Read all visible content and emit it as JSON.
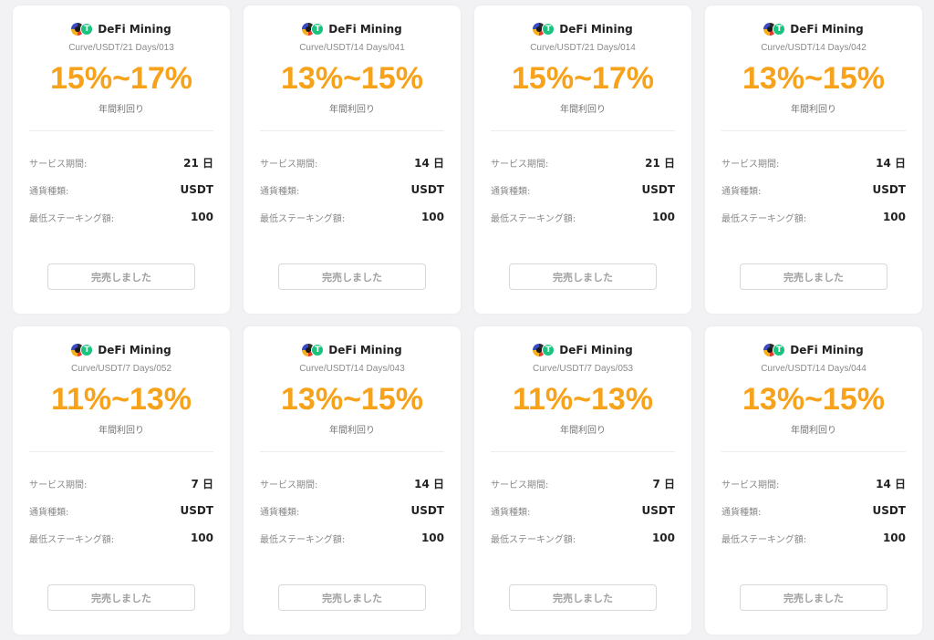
{
  "labels": {
    "brand": "DeFi Mining",
    "apy_label": "年間利回り",
    "service_period": "サービス期間:",
    "currency_type": "通貨種類:",
    "min_staking": "最低ステーキング額:",
    "sold_out": "完売しました",
    "usdt_symbol": "T"
  },
  "colors": {
    "apy": "#f7a21b",
    "usdt_green": "#19c37d"
  },
  "cards": [
    {
      "pool": "Curve/USDT/21 Days/013",
      "apy": "15%~17%",
      "period": "21 日",
      "currency": "USDT",
      "min": "100"
    },
    {
      "pool": "Curve/USDT/14 Days/041",
      "apy": "13%~15%",
      "period": "14 日",
      "currency": "USDT",
      "min": "100"
    },
    {
      "pool": "Curve/USDT/21 Days/014",
      "apy": "15%~17%",
      "period": "21 日",
      "currency": "USDT",
      "min": "100"
    },
    {
      "pool": "Curve/USDT/14 Days/042",
      "apy": "13%~15%",
      "period": "14 日",
      "currency": "USDT",
      "min": "100"
    },
    {
      "pool": "Curve/USDT/7 Days/052",
      "apy": "11%~13%",
      "period": "7 日",
      "currency": "USDT",
      "min": "100"
    },
    {
      "pool": "Curve/USDT/14 Days/043",
      "apy": "13%~15%",
      "period": "14 日",
      "currency": "USDT",
      "min": "100"
    },
    {
      "pool": "Curve/USDT/7 Days/053",
      "apy": "11%~13%",
      "period": "7 日",
      "currency": "USDT",
      "min": "100"
    },
    {
      "pool": "Curve/USDT/14 Days/044",
      "apy": "13%~15%",
      "period": "14 日",
      "currency": "USDT",
      "min": "100"
    }
  ]
}
